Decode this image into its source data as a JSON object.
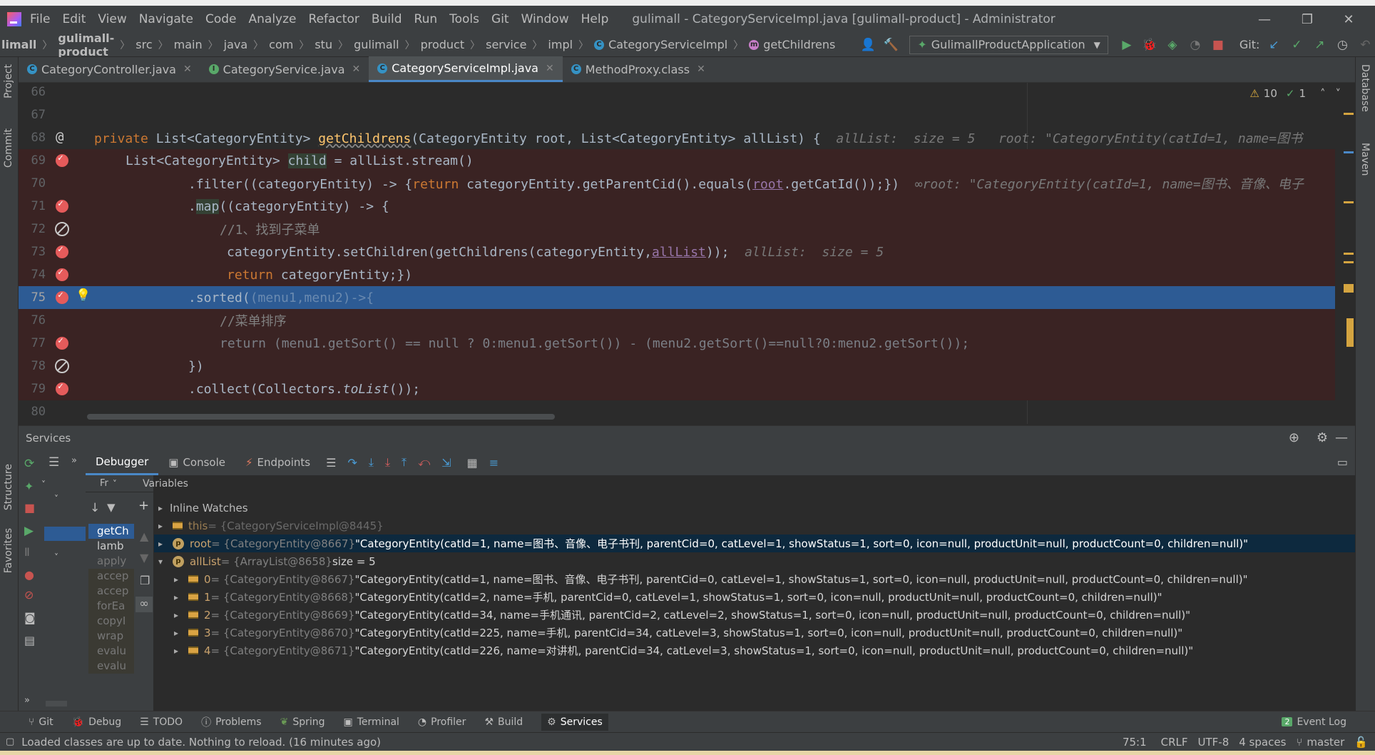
{
  "window": {
    "title": "gulimall - CategoryServiceImpl.java [gulimall-product] - Administrator",
    "menu": [
      "File",
      "Edit",
      "View",
      "Navigate",
      "Code",
      "Analyze",
      "Refactor",
      "Build",
      "Run",
      "Tools",
      "Git",
      "Window",
      "Help"
    ]
  },
  "breadcrumb": [
    "limall",
    "gulimall-product",
    "src",
    "main",
    "java",
    "com",
    "stu",
    "gulimall",
    "product",
    "service",
    "impl",
    "CategoryServiceImpl",
    "getChildrens"
  ],
  "toolbar": {
    "run_config": "GulimallProductApplication",
    "git_label": "Git:"
  },
  "tabs": [
    {
      "label": "CategoryController.java",
      "icon": "C"
    },
    {
      "label": "CategoryService.java",
      "icon": "I"
    },
    {
      "label": "CategoryServiceImpl.java",
      "icon": "C",
      "active": true
    },
    {
      "label": "MethodProxy.class",
      "icon": "C"
    }
  ],
  "inspections": {
    "warnings": "10",
    "ok": "1"
  },
  "code": {
    "lines": [
      {
        "n": "66"
      },
      {
        "n": "67"
      },
      {
        "n": "68"
      },
      {
        "n": "69"
      },
      {
        "n": "70"
      },
      {
        "n": "71"
      },
      {
        "n": "72"
      },
      {
        "n": "73"
      },
      {
        "n": "74"
      },
      {
        "n": "75"
      },
      {
        "n": "76"
      },
      {
        "n": "77"
      },
      {
        "n": "78"
      },
      {
        "n": "79"
      },
      {
        "n": "80"
      }
    ],
    "l68_a": "private ",
    "l68_b": "List<CategoryEntity> ",
    "l68_fn": "getChildrens",
    "l68_c": "(CategoryEntity root, List<CategoryEntity> allList) {",
    "l68_hint1": "allList:  size = 5",
    "l68_hint2": "root: \"CategoryEntity(catId=1, name=图书",
    "l69_a": "List<CategoryEntity> ",
    "l69_b": "child",
    "l69_c": " = allList.stream()",
    "l70_a": ".filter((categoryEntity) -> {",
    "l70_b": "return ",
    "l70_c": "categoryEntity.getParentCid().equals(",
    "l70_d": "root",
    "l70_e": ".getCatId());",
    "l70_f": "})",
    "l70_hint": "root: \"CategoryEntity(catId=1, name=图书、音像、电子",
    "l71_a": ".",
    "l71_b": "map",
    "l71_c": "((categoryEntity) -> {",
    "l72": "//1、找到子菜单",
    "l73_a": "categoryEntity.setChildren(getChildrens(categoryEntity,",
    "l73_b": "allList",
    "l73_c": "));",
    "l73_hint": "allList:  size = 5",
    "l74_a": "return ",
    "l74_b": "categoryEntity;",
    "l74_c": "})",
    "l75_a": ".sorted(",
    "l75_b": "(menu1,menu2)->{",
    "l76": "//菜单排序",
    "l77": "return (menu1.getSort() == null ? 0:menu1.getSort()) - (menu2.getSort()==null?0:menu2.getSort());",
    "l78": "})",
    "l79_a": ".collect(Collectors.",
    "l79_b": "toList",
    "l79_c": "());"
  },
  "services": {
    "title": "Services",
    "tabs": [
      "Debugger",
      "Console",
      "Endpoints"
    ],
    "frames_label": "Fr",
    "variables_label": "Variables",
    "frames": [
      "getCh",
      "lamb",
      "apply",
      "accep",
      "accep",
      "forEa",
      "copyI",
      "wrap",
      "evalu",
      "evalu"
    ],
    "vars": [
      {
        "indent": 0,
        "name": "Inline Watches",
        "type": "",
        "value": "",
        "kind": "none"
      },
      {
        "indent": 0,
        "name": "this",
        "type": " = {CategoryServiceImpl@8445}",
        "value": "",
        "kind": "field",
        "dim": true
      },
      {
        "indent": 0,
        "name": "root",
        "type": " = {CategoryEntity@8667}",
        "value": " \"CategoryEntity(catId=1, name=图书、音像、电子书刊, parentCid=0, catLevel=1, showStatus=1, sort=0, icon=null, productUnit=null, productCount=0, children=null)\"",
        "kind": "param",
        "sel": true
      },
      {
        "indent": 0,
        "name": "allList",
        "type": " = {ArrayList@8658}",
        "value": "  size = 5",
        "kind": "param",
        "open": true
      },
      {
        "indent": 1,
        "name": "0",
        "type": " = {CategoryEntity@8667}",
        "value": " \"CategoryEntity(catId=1, name=图书、音像、电子书刊, parentCid=0, catLevel=1, showStatus=1, sort=0, icon=null, productUnit=null, productCount=0, children=null)\"",
        "kind": "field"
      },
      {
        "indent": 1,
        "name": "1",
        "type": " = {CategoryEntity@8668}",
        "value": " \"CategoryEntity(catId=2, name=手机, parentCid=0, catLevel=1, showStatus=1, sort=0, icon=null, productUnit=null, productCount=0, children=null)\"",
        "kind": "field"
      },
      {
        "indent": 1,
        "name": "2",
        "type": " = {CategoryEntity@8669}",
        "value": " \"CategoryEntity(catId=34, name=手机通讯, parentCid=2, catLevel=2, showStatus=1, sort=0, icon=null, productUnit=null, productCount=0, children=null)\"",
        "kind": "field"
      },
      {
        "indent": 1,
        "name": "3",
        "type": " = {CategoryEntity@8670}",
        "value": " \"CategoryEntity(catId=225, name=手机, parentCid=34, catLevel=3, showStatus=1, sort=0, icon=null, productUnit=null, productCount=0, children=null)\"",
        "kind": "field"
      },
      {
        "indent": 1,
        "name": "4",
        "type": " = {CategoryEntity@8671}",
        "value": " \"CategoryEntity(catId=226, name=对讲机, parentCid=34, catLevel=3, showStatus=1, sort=0, icon=null, productUnit=null, productCount=0, children=null)\"",
        "kind": "field"
      }
    ]
  },
  "bottom_tabs": [
    "Git",
    "Debug",
    "TODO",
    "Problems",
    "Spring",
    "Terminal",
    "Profiler",
    "Build",
    "Services"
  ],
  "event_log": "Event Log",
  "event_count": "2",
  "left_tools": [
    "Project",
    "Commit",
    "Structure",
    "Favorites"
  ],
  "right_tools": [
    "Database",
    "Maven"
  ],
  "status": {
    "message": "Loaded classes are up to date. Nothing to reload. (16 minutes ago)",
    "position": "75:1",
    "line_sep": "CRLF",
    "encoding": "UTF-8",
    "indent": "4 spaces",
    "branch": "master"
  }
}
